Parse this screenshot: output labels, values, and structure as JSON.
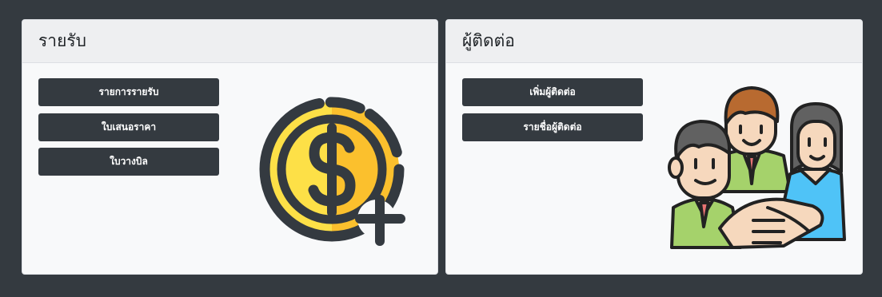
{
  "income": {
    "title": "รายรับ",
    "buttons": [
      "รายการรายรับ",
      "ใบเสนอราคา",
      "ใบวางบิล"
    ],
    "icon": "coin-dollar-plus-icon"
  },
  "contacts": {
    "title": "ผู้ติดต่อ",
    "buttons": [
      "เพิ่มผู้ติดต่อ",
      "รายชื่อผู้ติดต่อ"
    ],
    "icon": "team-handshake-icon"
  },
  "colors": {
    "background": "#343a40",
    "card": "#f8f9fa",
    "card_header": "#eeeff1",
    "button": "#343a40",
    "coin_gold": "#fbc02d",
    "coin_light": "#fde047"
  }
}
